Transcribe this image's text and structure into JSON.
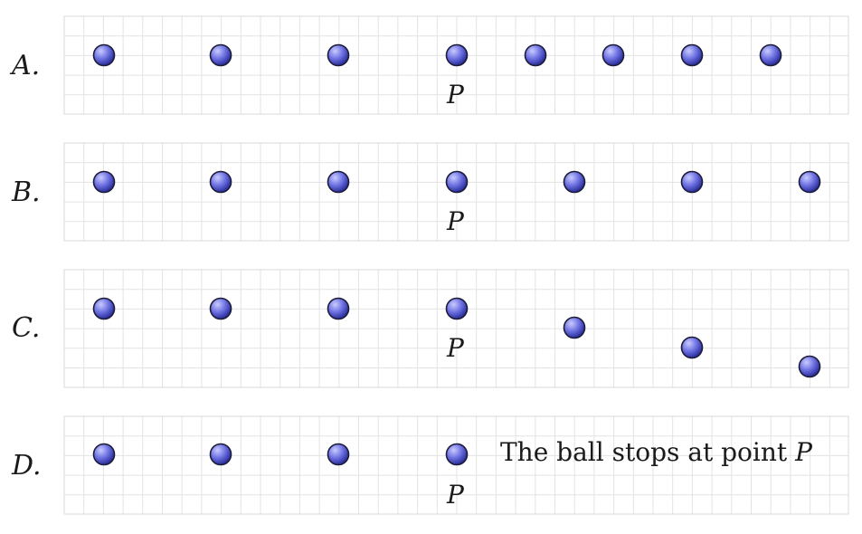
{
  "options": [
    {
      "label": "A.",
      "point_label": "P",
      "note": ""
    },
    {
      "label": "B.",
      "point_label": "P",
      "note": ""
    },
    {
      "label": "C.",
      "point_label": "P",
      "note": ""
    },
    {
      "label": "D.",
      "point_label": "P",
      "note": "The ball stops at point",
      "note_suffix": "P"
    }
  ],
  "colors": {
    "ball_fill_light": "#c9cbff",
    "ball_fill_mid": "#6b6fe0",
    "ball_fill_dark": "#2b2f9a",
    "ball_stroke": "#1c1c3a",
    "grid_line": "#e3e3e3",
    "panel_border": "#d9d9d9"
  }
}
